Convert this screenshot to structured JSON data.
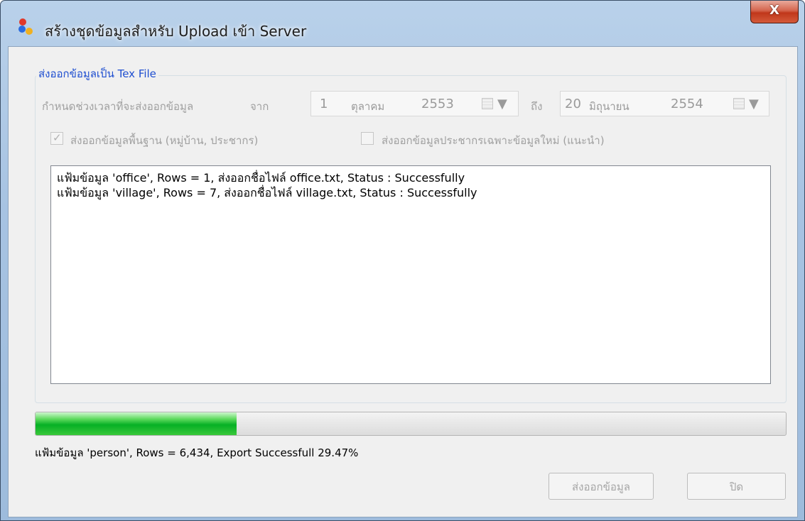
{
  "window": {
    "title": "สร้างชุดข้อมูลสำหรับ Upload เข้า Server",
    "close_label": "X"
  },
  "group": {
    "legend": "ส่งออกข้อมูลเป็น Tex File",
    "period_label": "กำหนดช่วงเวลาที่จะส่งออกข้อมูล",
    "from_label": "จาก",
    "to_label": "ถึง",
    "from_date": {
      "day": "1",
      "month": "ตุลาคม",
      "year": "2553"
    },
    "to_date": {
      "day": "20",
      "month": "มิถุนายน",
      "year": "2554"
    },
    "checkbox_basic": {
      "label": "ส่งออกข้อมูลพื้นฐาน (หมู่บ้าน, ประชากร)",
      "checked": true
    },
    "checkbox_new": {
      "label": "ส่งออกข้อมูลประชากรเฉพาะข้อมูลใหม่ (แนะนำ)",
      "checked": false
    }
  },
  "log": {
    "lines": [
      "แฟ้มข้อมูล 'office', Rows = 1, ส่งออกชื่อไฟล์ office.txt, Status : Successfully",
      "แฟ้มข้อมูล 'village', Rows = 7, ส่งออกชื่อไฟล์ village.txt, Status : Successfully"
    ]
  },
  "progress": {
    "percent": 26.8,
    "status_text": "แฟ้มข้อมูล 'person', Rows = 6,434, Export Successfull 29.47%"
  },
  "buttons": {
    "export_label": "ส่งออกข้อมูล",
    "close_label": "ปิด"
  }
}
